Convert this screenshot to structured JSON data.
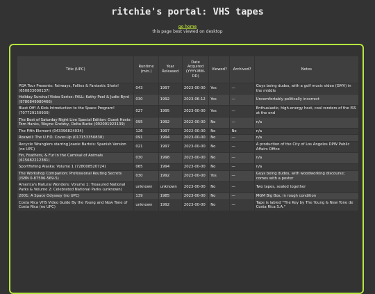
{
  "page": {
    "title": "ritchie's portal: VHS tapes",
    "home_link": "go home",
    "subtitle": "this page best viewed on desktop"
  },
  "table": {
    "headers": [
      "Title (UPC)",
      "Runtime (min.)",
      "Year Released",
      "Date Acquired (YYYY-MM-DD)",
      "Viewed?",
      "Archived?",
      "Notes"
    ],
    "rows": [
      [
        "PGA Tour Presents: Fairways, Follies & Fantastic Shots! (650833000137)",
        "043",
        "1997",
        "2023-00-00",
        "Yes",
        "—",
        "Guys being dudes, with a golf music video (GMV) in the middle"
      ],
      [
        "Holiday Survival Video Series: FALL: Kathy Peel & Judie Byrd (9780849980466)",
        "030",
        "1992",
        "2023-06-12",
        "Yes",
        "—",
        "Uncomfortably politically incorrect"
      ],
      [
        "Blast Off! A Kids Introduction to the Space Program! (707729150930)",
        "027",
        "1995",
        "2023-00-00",
        "Yes",
        "—",
        "Enthusiastic, high-energy host, cool renders of the ISS at the end"
      ],
      [
        "The Best of Saturday Night Live Special Edition: Guest Hosts: Tom Hanks, Wayne Gretzky, Delta Burke (092091923139)",
        "095",
        "1992",
        "2022-00-00",
        "No",
        "—",
        "n/a"
      ],
      [
        "The Fifth Element (043396824034)",
        "126",
        "1997",
        "2022-00-00",
        "No",
        "No",
        "n/a"
      ],
      [
        "Roswell: The U.F.O. Cover-Up (017153350838)",
        "091",
        "1994",
        "2023-00-00",
        "No",
        "—",
        "n/a"
      ],
      [
        "Recycle Wranglers starring Joanie Bartels: Spanish Version (no UPC)",
        "021",
        "1997",
        "2023-00-00",
        "No",
        "—",
        "A production of the City of Los Angeles DPW Public Affairs Office"
      ],
      [
        "Fin, Feathers, & Fur In the Carnival of Animals (615682212381)",
        "030",
        "1998",
        "2023-00-00",
        "No",
        "—",
        "n/a"
      ],
      [
        "Sportfishing Alaska: Volume 1 (728008520724)",
        "065",
        "1994",
        "2023-00-00",
        "No",
        "—",
        "n/a"
      ],
      [
        "The Workshop Companion: Professional Routing Secrets (ISBN 0-87596-569-5)",
        "030",
        "1992",
        "2023-00-00",
        "Yes",
        "—",
        "Guys being dudes, with woodworking discourse; comes with a poster"
      ],
      [
        "America's Natural Wonders: Volume 1: Treasured National Parks & Volume 2: Celebrated National Parks (unknown)",
        "unknown",
        "unknown",
        "2023-00-00",
        "No",
        "—",
        "Two tapes, sealed together"
      ],
      [
        "2001: A Space Odyssey (no UPC)",
        "139",
        "1985",
        "2023-00-00",
        "No",
        "—",
        "MGM Big Box, in rough condition"
      ],
      [
        "Costa Rica VHS Video Guide By the Young and New Tone of Costa Rica (no UPC)",
        "unknown",
        "1992",
        "2023-00-00",
        "No",
        "—",
        "Tape is labled \"The Key by The Young & New Tone de Costa Rica S.A.\""
      ]
    ]
  }
}
